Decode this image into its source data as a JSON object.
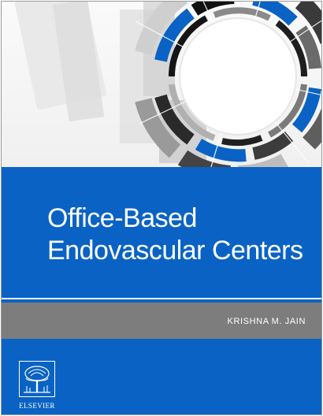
{
  "cover": {
    "title_line_1": "Office-Based",
    "title_line_2": "Endovascular Centers",
    "author": "KRISHNA M. JAIN",
    "publisher": "ELSEVIER"
  },
  "icons": {
    "abstract_art": "radial-lens-graphic",
    "publisher_logo": "elsevier-tree-logo"
  },
  "colors": {
    "brand_blue": "#0a63c4",
    "band_gray": "#7d7d7d",
    "text_white": "#ffffff"
  }
}
